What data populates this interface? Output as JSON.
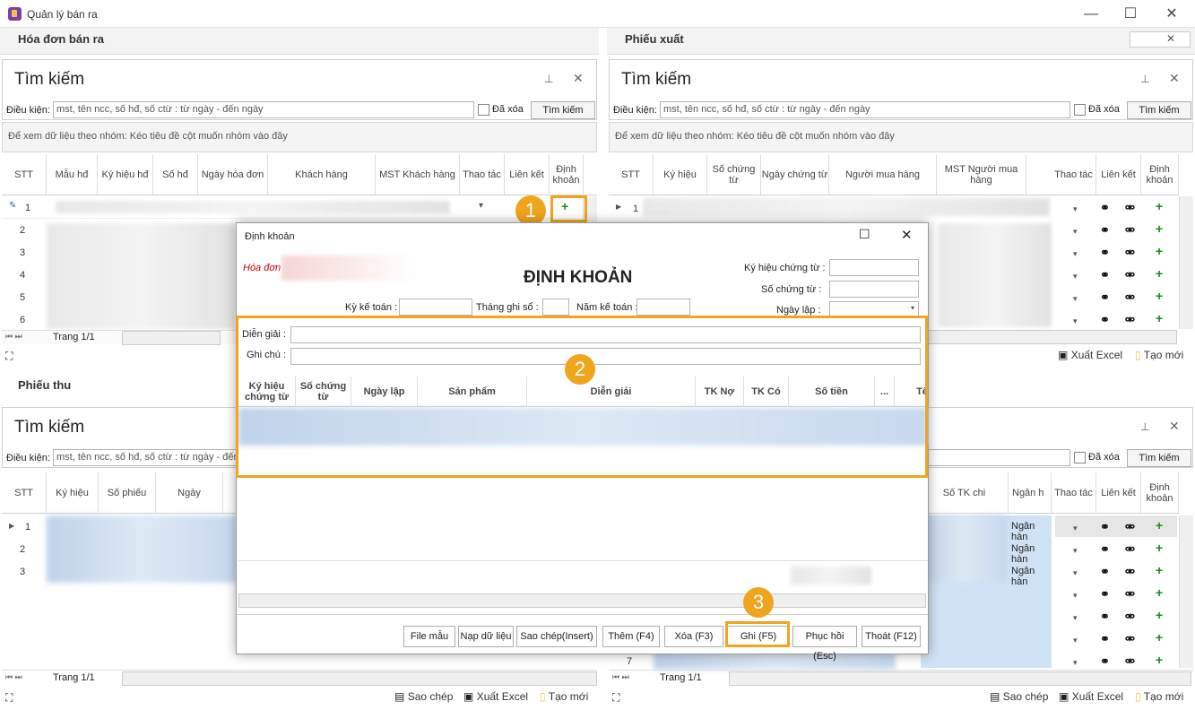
{
  "window": {
    "title": "Quản lý bán ra",
    "minimize": "—",
    "maximize": "☐",
    "close": "✕"
  },
  "left_top": {
    "panel_title": "Hóa đơn bán ra",
    "search_title": "Tìm kiếm",
    "condition_label": "Điều kiện:",
    "condition_placeholder": "mst, tên ncc, số hđ, số ctừ : từ ngày - đến ngày",
    "deleted_label": "Đã xóa",
    "search_button": "Tìm kiếm",
    "group_hint": "Để xem dữ liệu theo nhóm: Kéo tiêu đề cột muốn nhóm vào đây",
    "columns": [
      "STT",
      "Mẫu hđ",
      "Ký hiệu hđ",
      "Số hđ",
      "Ngày hóa đơn",
      "Khách hàng",
      "MST Khách hàng",
      "Thao tác",
      "Liên kết",
      "Định khoản"
    ],
    "rows": [
      "1",
      "2",
      "3",
      "4",
      "5",
      "6"
    ],
    "page": "Trang 1/1"
  },
  "right_top": {
    "panel_title": "Phiếu xuất",
    "search_title": "Tìm kiếm",
    "condition_label": "Điều kiện:",
    "condition_placeholder": "mst, tên ncc, số hđ, số ctừ : từ ngày - đến ngày",
    "deleted_label": "Đã xóa",
    "search_button": "Tìm kiếm",
    "group_hint": "Để xem dữ liệu theo nhóm: Kéo tiêu đề cột muốn nhóm vào đây",
    "columns": [
      "STT",
      "Ký hiệu",
      "Số chứng từ",
      "Ngày chứng từ",
      "Người mua hàng",
      "MST Người mua hàng",
      "Thao tác",
      "Liên kết",
      "Định khoản"
    ],
    "rows": [
      "1"
    ],
    "export_excel": "Xuất Excel",
    "new": "Tạo mới"
  },
  "left_bottom": {
    "panel_title": "Phiếu thu",
    "search_title": "Tìm kiếm",
    "condition_label": "Điều kiện:",
    "condition_placeholder": "mst, tên ncc, số hđ, số ctừ : từ ngày - đến",
    "columns": [
      "STT",
      "Ký hiệu",
      "Số phiếu",
      "Ngày"
    ],
    "rows": [
      "1",
      "2",
      "3"
    ],
    "page": "Trang 1/1",
    "copy": "Sao chép",
    "export_excel": "Xuất Excel",
    "new": "Tạo mới"
  },
  "right_bottom": {
    "search_button": "Tìm kiếm",
    "deleted_label": "Đã xóa",
    "columns": [
      "Số TK chi",
      "Ngân h",
      "Thao tác",
      "Liên kết",
      "Định khoản"
    ],
    "bank_text": "Ngân hàn",
    "last_row": "7",
    "page": "Trang 1/1",
    "copy": "Sao chép",
    "export_excel": "Xuất Excel",
    "new": "Tạo mới"
  },
  "dialog": {
    "title": "Định khoản",
    "heading": "ĐỊNH KHOẢN",
    "invoice_label": "Hóa đơn",
    "symbol_label": "Ký hiệu chứng từ :",
    "doc_no_label": "Số chứng từ :",
    "date_label": "Ngày lập :",
    "period_label": "Kỳ kế toán :",
    "month_label": "Tháng ghi sổ :",
    "year_label": "Năm kế toán :",
    "desc_label": "Diễn giải :",
    "note_label": "Ghi chú :",
    "columns": [
      "Ký hiệu chứng từ",
      "Số chứng từ",
      "Ngày lập",
      "Sản phẩm",
      "Diễn giải",
      "TK Nợ",
      "TK Có",
      "Số tiền",
      "...",
      "Tê"
    ],
    "buttons": {
      "template": "File mẫu",
      "load": "Nạp dữ liệu",
      "copy": "Sao chép(Insert)",
      "add": "Thêm (F4)",
      "delete": "Xóa (F3)",
      "save": "Ghi (F5)",
      "restore": "Phục hồi (Esc)",
      "exit": "Thoát (F12)"
    }
  },
  "badges": [
    "1",
    "2",
    "3"
  ],
  "colors": {
    "accent": "#f0a51e",
    "plus": "#1a8a1a",
    "selected_row": "#cfe2f5"
  }
}
